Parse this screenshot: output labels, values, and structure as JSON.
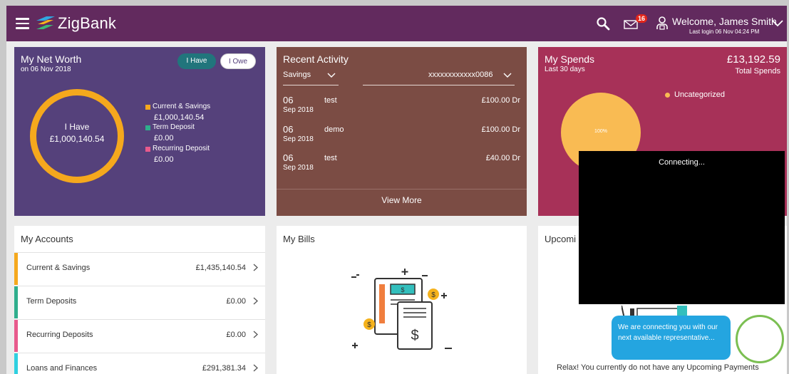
{
  "header": {
    "brand": "ZigBank",
    "mail_count": "16",
    "welcome": "Welcome, James Smith",
    "last_login": "Last login 06 Nov 04:24 PM"
  },
  "networth": {
    "title": "My Net Worth",
    "date": "on 06 Nov 2018",
    "toggle_have": "I Have",
    "toggle_owe": "I Owe",
    "center_label": "I Have",
    "center_value": "£1,000,140.54",
    "legend": [
      {
        "label": "Current & Savings",
        "value": "£1,000,140.54",
        "color": "#f5a81d"
      },
      {
        "label": "Term Deposit",
        "value": "£0.00",
        "color": "#2fae8c"
      },
      {
        "label": "Recurring Deposit",
        "value": "£0.00",
        "color": "#e85a8c"
      }
    ]
  },
  "activity": {
    "title": "Recent Activity",
    "type_select": "Savings",
    "account_select": "xxxxxxxxxxxx0086",
    "items": [
      {
        "day": "06",
        "month": "Sep 2018",
        "desc": "test",
        "amount": "£100.00 Dr"
      },
      {
        "day": "06",
        "month": "Sep 2018",
        "desc": "demo",
        "amount": "£100.00 Dr"
      },
      {
        "day": "06",
        "month": "Sep 2018",
        "desc": "test",
        "amount": "£40.00 Dr"
      }
    ],
    "view_more": "View More"
  },
  "spends": {
    "title": "My Spends",
    "period": "Last 30 days",
    "amount": "£13,192.59",
    "total_label": "Total Spends",
    "pie_label": "100%",
    "legend_label": "Uncategorized"
  },
  "accounts": {
    "title": "My Accounts",
    "rows": [
      {
        "name": "Current & Savings",
        "value": "£1,435,140.54",
        "color": "#f5a81d"
      },
      {
        "name": "Term Deposits",
        "value": "£0.00",
        "color": "#2fae8c"
      },
      {
        "name": "Recurring Deposits",
        "value": "£0.00",
        "color": "#e85a8c"
      },
      {
        "name": "Loans and Finances",
        "value": "£291,381.34",
        "color": "#2fd0e0"
      }
    ]
  },
  "bills": {
    "title": "My Bills"
  },
  "upcoming": {
    "title": "Upcomi",
    "message": "Relax! You currently do not have any Upcoming Payments"
  },
  "overlay": {
    "status": "Connecting...",
    "chat_message": "We are connecting you with our next available representative..."
  }
}
